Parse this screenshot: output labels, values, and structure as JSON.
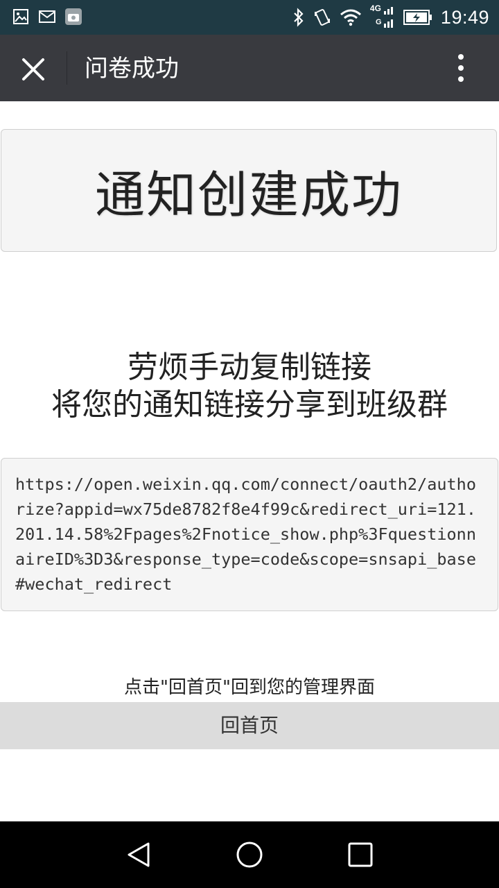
{
  "status_bar": {
    "time": "19:49",
    "network": "4G",
    "icons": [
      "image-icon",
      "mail-icon",
      "camera-app-icon",
      "bluetooth-icon",
      "vibrate-icon",
      "wifi-icon",
      "signal-icon",
      "battery-icon"
    ]
  },
  "title_bar": {
    "title": "问卷成功",
    "close_icon": "close-icon",
    "more_icon": "more-vertical-icon"
  },
  "main": {
    "success_message": "通知创建成功",
    "instruction_line1": "劳烦手动复制链接",
    "instruction_line2": "将您的通知链接分享到班级群",
    "link": "https://open.weixin.qq.com/connect/oauth2/authorize?appid=wx75de8782f8e4f99c&redirect_uri=121.201.14.58%2Fpages%2Fnotice_show.php%3FquestionnaireID%3D3&response_type=code&scope=snsapi_base#wechat_redirect",
    "hint": "点击\"回首页\"回到您的管理界面",
    "home_button": "回首页"
  },
  "nav_bar": {
    "icons": [
      "back-triangle-icon",
      "home-circle-icon",
      "recents-square-icon"
    ]
  },
  "colors": {
    "status_bar_bg": "#1f3a44",
    "title_bar_bg": "#393a3f",
    "box_bg": "#f5f5f5",
    "home_button_bg": "#dcdcdc"
  }
}
